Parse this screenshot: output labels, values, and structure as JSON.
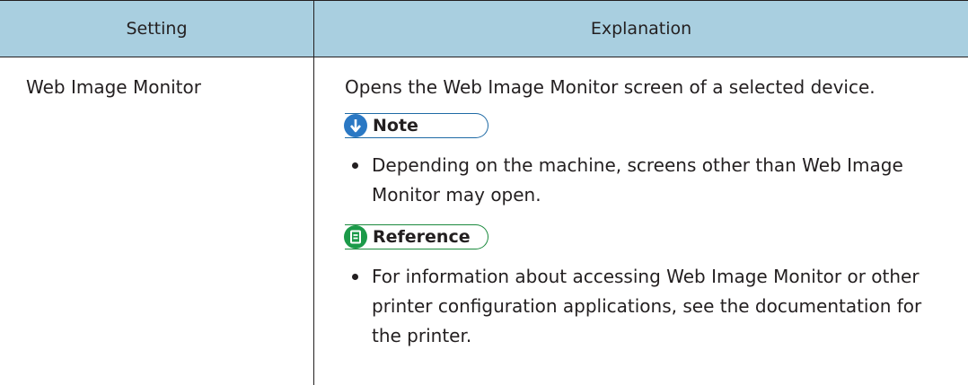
{
  "header": {
    "setting": "Setting",
    "explanation": "Explanation"
  },
  "row": {
    "setting": "Web Image Monitor",
    "explanation": "Opens the Web Image Monitor screen of a selected device.",
    "note": {
      "label": "Note",
      "icon": "down-arrow-icon",
      "items": [
        "Depending on the machine, screens other than Web Image Monitor may open."
      ]
    },
    "reference": {
      "label": "Reference",
      "icon": "book-icon",
      "items": [
        "For information about accessing Web Image Monitor or other printer configuration applications, see the documentation for the printer."
      ]
    }
  },
  "colors": {
    "header_bg": "#a9cfe0",
    "note_blue": "#2a78c4",
    "reference_green": "#1b9a49",
    "text": "#231f20"
  }
}
